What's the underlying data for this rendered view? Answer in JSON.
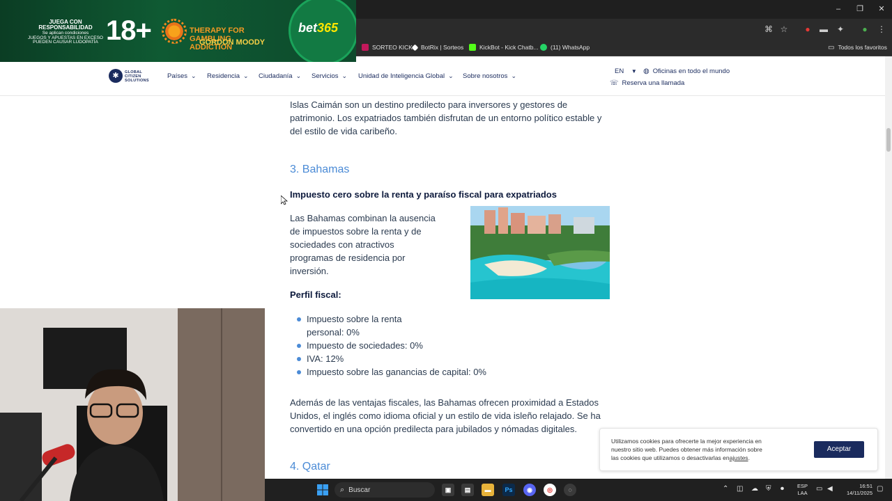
{
  "browser": {
    "bookmarks": [
      {
        "label": "SORTEO KICK",
        "color": "#c2185b"
      },
      {
        "label": "BotRix | Sorteos",
        "color": "#ffffff"
      },
      {
        "label": "KickBot - Kick Chatb...",
        "color": "#53fc18"
      },
      {
        "label": "(11) WhatsApp",
        "color": "#25d366"
      }
    ],
    "all_favorites": "Todos los favoritos"
  },
  "ad": {
    "responsible_line1": "JUEGA CON RESPONSABILIDAD",
    "responsible_line2": "Se aplican condiciones",
    "responsible_line3": "JUEGOS Y APUESTAS EN EXCESO PUEDEN CAUSAR LUDOPATÍA",
    "age": "18+",
    "therapy": "THERAPY FOR GAMBLING ADDICTION",
    "gordon": "GORDON MOODY",
    "brand": "bet",
    "brand_suffix": "365"
  },
  "site": {
    "logo": "GLOBAL CITIZEN SOLUTIONS",
    "nav": [
      "Países",
      "Residencia",
      "Ciudadanía",
      "Servicios",
      "Unidad de Inteligencia Global",
      "Sobre nosotros"
    ],
    "lang": "EN",
    "offices": "Oficinas en todo el mundo",
    "call": "Reserva una llamada"
  },
  "article": {
    "intro_line1": "Islas Caimán son un destino predilecto para inversores y gestores de",
    "intro_line2": "patrimonio. Los expatriados también disfrutan de un entorno político estable y",
    "intro_line3": "del estilo de vida caribeño.",
    "section_title": "3. Bahamas",
    "subtitle": "Impuesto cero sobre la renta y paraíso fiscal para expatriados",
    "body_line1": "Las Bahamas combinan la ausencia",
    "body_line2": "de impuestos sobre la renta y de",
    "body_line3": "sociedades con atractivos",
    "body_line4": "programas de residencia por",
    "body_line5": "inversión.",
    "fiscal_title": "Perfil fiscal:",
    "fiscal_items": [
      "Impuesto sobre la renta",
      "personal: 0%",
      "Impuesto de sociedades: 0%",
      "IVA: 12%",
      "Impuesto sobre las ganancias de capital: 0%"
    ],
    "outro_line1": "Además de las ventajas fiscales, las Bahamas ofrecen proximidad a Estados",
    "outro_line2": "Unidos, el inglés como idioma oficial y un estilo de vida isleño relajado. Se ha",
    "outro_line3": "convertido en una opción predilecta para jubilados y nómadas digitales.",
    "next_section": "4. Qatar"
  },
  "cookie": {
    "line1": "Utilizamos cookies para ofrecerte la mejor experiencia en",
    "line2": "nuestro sitio web. Puedes obtener más información sobre",
    "line3_pre": "las cookies que utilizamos o desactivarlas en",
    "line3_link": "ajustes",
    "line3_post": ".",
    "accept": "Aceptar"
  },
  "taskbar": {
    "search": "Buscar",
    "lang_line1": "ESP",
    "lang_line2": "LAA",
    "time": "16:51",
    "date": "14/11/2025"
  }
}
